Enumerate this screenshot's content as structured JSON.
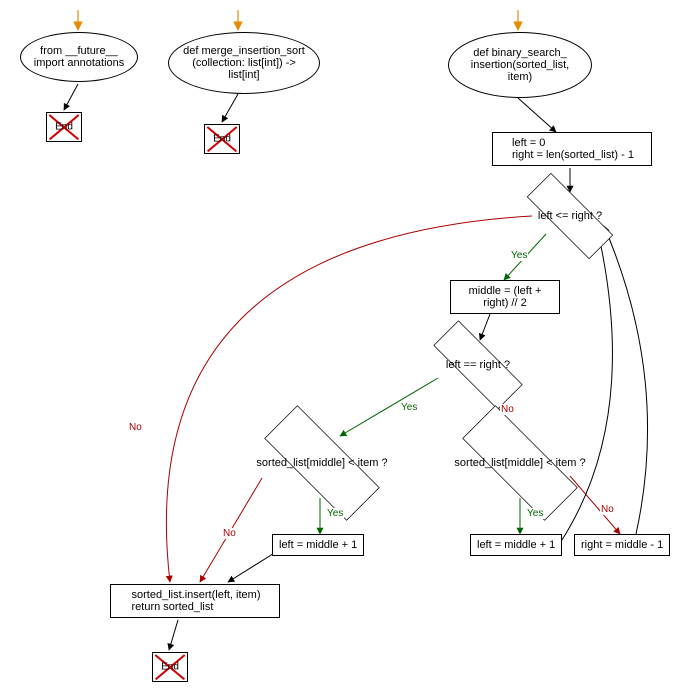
{
  "flowchart": {
    "func1": {
      "def_lines": "from __future__ import annotations"
    },
    "func2": {
      "def_lines": "def merge_insertion_sort (collection: list[int]) -> list[int]"
    },
    "func3": {
      "def_lines": "def binary_search_ insertion(sorted_list, item)",
      "init_block": "left = 0\nright = len(sorted_list) - 1",
      "loop_cond": "left <= right ?",
      "middle_assign": "middle = (left + right) // 2",
      "eq_cond": "left == right ?",
      "cmp_cond_a": "sorted_list[middle] < item ?",
      "cmp_cond_b": "sorted_list[middle] < item ?",
      "left_mid_plus_a": "left = middle + 1",
      "left_mid_plus_b": "left = middle + 1",
      "right_mid_minus": "right = middle - 1",
      "final_block": "sorted_list.insert(left, item)\nreturn sorted_list"
    },
    "labels": {
      "yes": "Yes",
      "no": "No",
      "end": "End"
    }
  }
}
